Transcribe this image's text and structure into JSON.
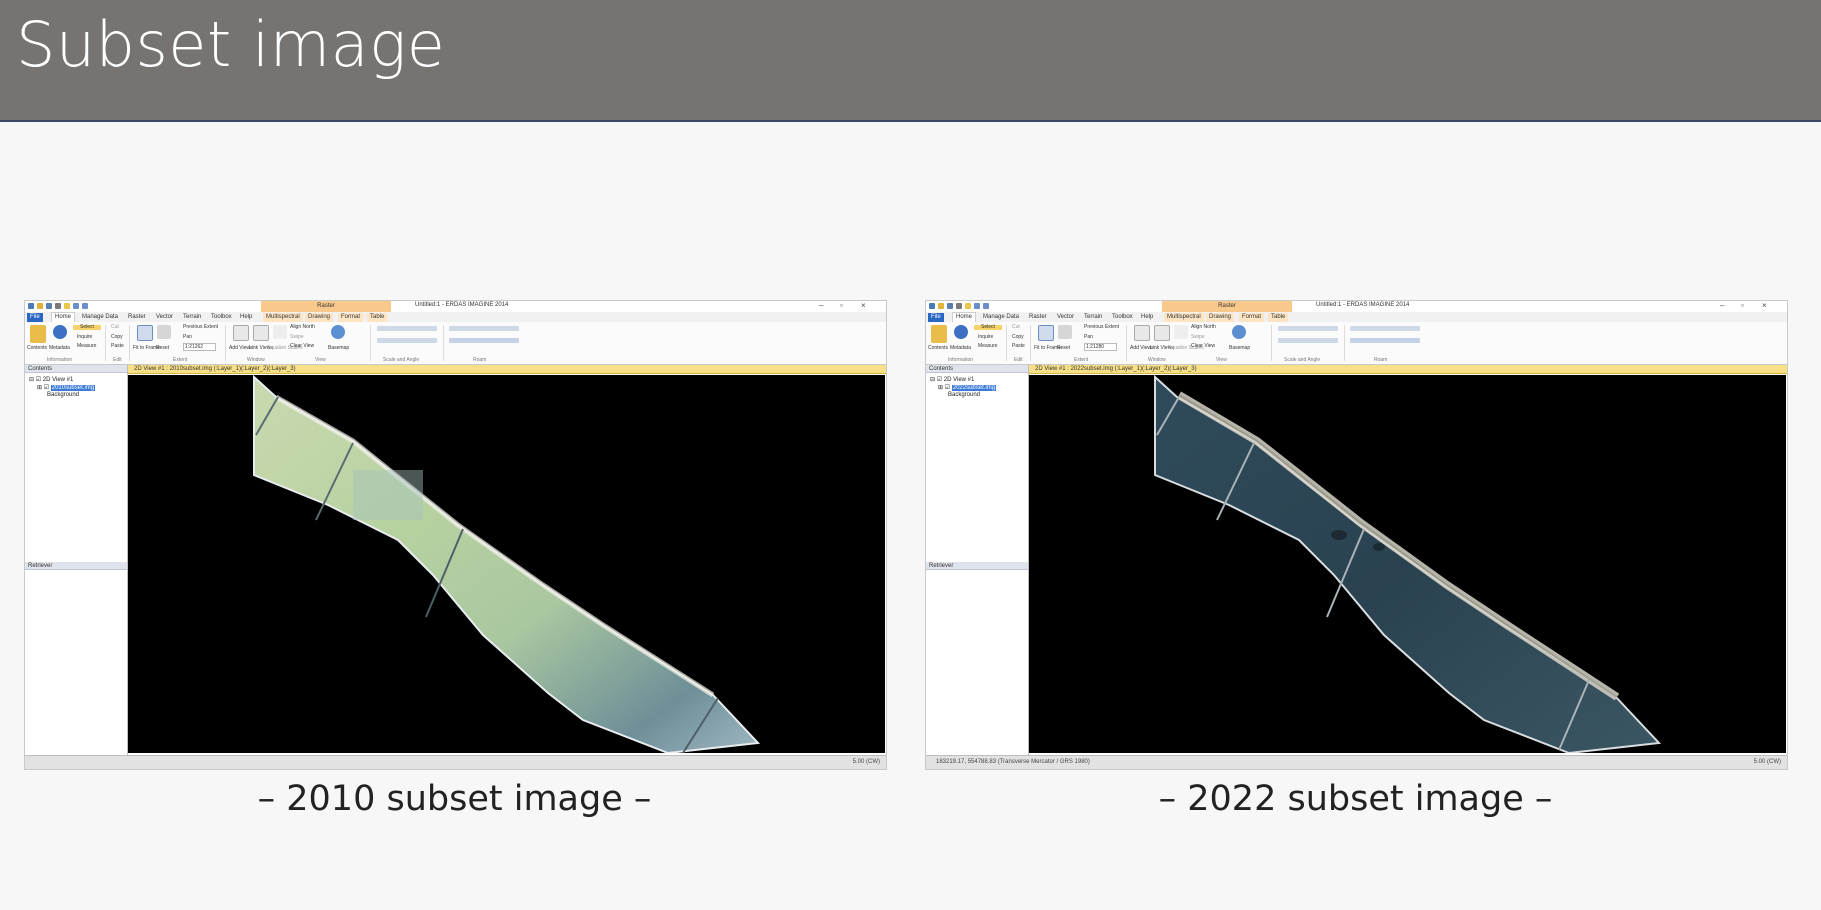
{
  "slide": {
    "title": "Subset image"
  },
  "screens": [
    {
      "app_title": "Untitled:1 - ERDAS IMAGINE 2014",
      "context_tab": "Raster",
      "tabs": [
        "File",
        "Home",
        "Manage Data",
        "Raster",
        "Vector",
        "Terrain",
        "Toolbox",
        "Help",
        "Multispectral",
        "Drawing",
        "Format",
        "Table"
      ],
      "ribbon": {
        "contents": "Contents",
        "metadata": "Metadata",
        "select": "Select",
        "inquire": "Inquire",
        "measure": "Measure",
        "cut": "Cut",
        "copy": "Copy",
        "paste": "Paste",
        "fit_to_frame": "Fit to Frame",
        "reset": "Reset",
        "previous_extent": "Previous Extent",
        "pan": "Pan",
        "scale": "1:21262",
        "add_views": "Add Views",
        "link_views": "Link Views",
        "equalize_scales": "Equalize Scales",
        "align_north": "Align North",
        "swipe": "Swipe",
        "clear_view": "Clear View",
        "basemap": "Basemap",
        "groups": [
          "Information",
          "Edit",
          "Extent",
          "Window",
          "View",
          "Scale and Angle",
          "Roam"
        ]
      },
      "contents_pane": "Contents",
      "tree": {
        "view": "2D View #1",
        "layer": "2010subset.img",
        "background": "Background"
      },
      "retriever_pane": "Retriever",
      "view_header": "2D View #1 : 2010subset.img (:Layer_1)(:Layer_2)(:Layer_3)",
      "status_left": "",
      "status_right": "5.00 (CW)",
      "caption": "– 2010 subset image –"
    },
    {
      "app_title": "Untitled:1 - ERDAS IMAGINE 2014",
      "context_tab": "Raster",
      "tabs": [
        "File",
        "Home",
        "Manage Data",
        "Raster",
        "Vector",
        "Terrain",
        "Toolbox",
        "Help",
        "Multispectral",
        "Drawing",
        "Format",
        "Table"
      ],
      "ribbon": {
        "contents": "Contents",
        "metadata": "Metadata",
        "select": "Select",
        "inquire": "Inquire",
        "measure": "Measure",
        "cut": "Cut",
        "copy": "Copy",
        "paste": "Paste",
        "fit_to_frame": "Fit to Frame",
        "reset": "Reset",
        "previous_extent": "Previous Extent",
        "pan": "Pan",
        "scale": "1:21280",
        "add_views": "Add Views",
        "link_views": "Link Views",
        "equalize_scales": "Equalize Scales",
        "align_north": "Align North",
        "swipe": "Swipe",
        "clear_view": "Clear View",
        "basemap": "Basemap",
        "groups": [
          "Information",
          "Edit",
          "Extent",
          "Window",
          "View",
          "Scale and Angle",
          "Roam"
        ]
      },
      "contents_pane": "Contents",
      "tree": {
        "view": "2D View #1",
        "layer": "2022subset.img",
        "background": "Background"
      },
      "retriever_pane": "Retriever",
      "view_header": "2D View #1 : 2022subset.img (:Layer_1)(:Layer_2)(:Layer_3)",
      "status_left": "183219.17, 554788.83   (Transverse Mercator / GRS 1980)",
      "status_right": "5.00 (CW)",
      "caption": "– 2022 subset image –"
    }
  ],
  "colors": {
    "title_bar": "#777370",
    "ribbon_file_tab": "#2a67c2",
    "raster_context": "#f9c98c",
    "view_header": "#f8e087",
    "image_2010_tint": "#b9d2a8",
    "image_2022_tint": "#2c4452"
  }
}
